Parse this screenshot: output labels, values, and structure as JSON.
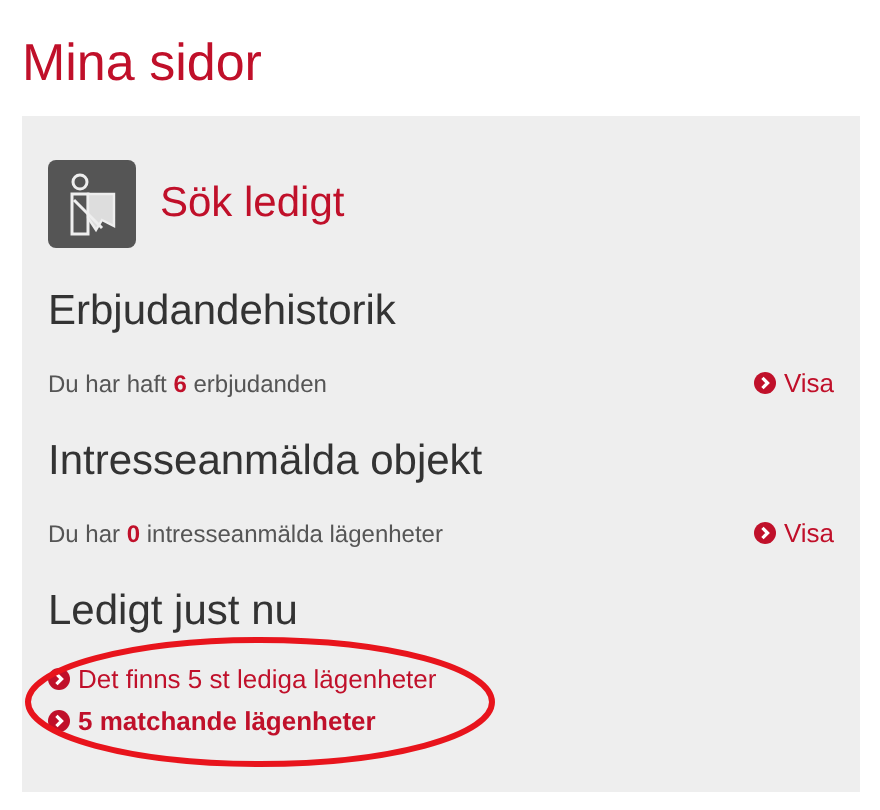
{
  "page_title": "Mina sidor",
  "search_link": {
    "label": "Sök ledigt"
  },
  "sections": [
    {
      "heading": "Erbjudandehistorik",
      "text": "Du har haft **6** erbjudanden",
      "link": "Visa"
    },
    {
      "heading": "Intresseanmälda objekt",
      "text": "Du har **0** intresseanmälda lägenheter",
      "link": "Visa"
    },
    {
      "heading": "Ledigt just nu",
      "links": [
        {
          "label": "Det finns 5 st lediga lägenheter",
          "kind": "normal"
        },
        {
          "label": "5 matchande lägenheter",
          "kind": "bold"
        }
      ]
    }
  ]
}
